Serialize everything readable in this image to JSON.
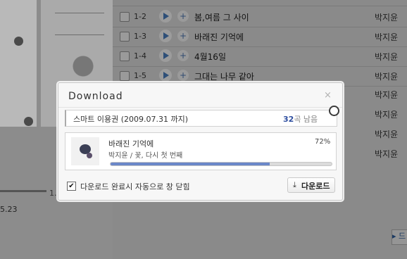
{
  "background": {
    "tracks": [
      {
        "num": "1-2",
        "title": "봄,여름 그 사이",
        "artist": "박지윤"
      },
      {
        "num": "1-3",
        "title": "바래진 기억에",
        "artist": "박지윤"
      },
      {
        "num": "1-4",
        "title": "4월16일",
        "artist": "박지윤"
      },
      {
        "num": "1-5",
        "title": "그대는 나무 같아",
        "artist": "박지윤"
      }
    ],
    "more_artists": [
      "박지윤",
      "박지윤",
      "박지윤",
      "박지윤"
    ],
    "time_text": "5.23",
    "time_num": "1.",
    "page_btn": "▸ 드",
    "icons": {
      "play": "play-icon",
      "add": "plus-icon"
    }
  },
  "modal": {
    "title": "Download",
    "close": "×",
    "voucher": {
      "label": "스마트 이용권 (2009.07.31 까지)",
      "count": "32",
      "suffix": "곡 남음"
    },
    "download": {
      "song_title": "바래진 기억에",
      "song_sub": "박지윤 / 꽃, 다시 첫 번째",
      "percent_text": "72%",
      "progress": 0.72
    },
    "auto_close_checked": true,
    "auto_close_label": "다운로드 완료시 자동으로 창 닫힘",
    "button": {
      "label": "다운로드",
      "icon": "download-icon"
    },
    "colors": {
      "progress_fill": "#6b87c8",
      "count": "#2f4fa0"
    }
  }
}
